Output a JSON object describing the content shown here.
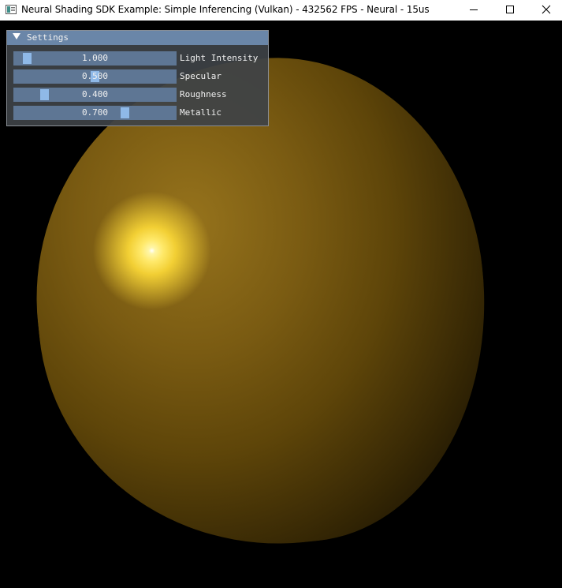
{
  "window": {
    "title": "Neural Shading SDK Example: Simple Inferencing (Vulkan) - 432562 FPS  - Neural -  15us"
  },
  "settings": {
    "header": "Settings",
    "sliders": [
      {
        "label": "Light Intensity",
        "value": "1.000",
        "fraction": 0.04
      },
      {
        "label": "Specular",
        "value": "0.500",
        "fraction": 0.5
      },
      {
        "label": "Roughness",
        "value": "0.400",
        "fraction": 0.16
      },
      {
        "label": "Metallic",
        "value": "0.700",
        "fraction": 0.7
      }
    ]
  },
  "colors": {
    "titlebar_bg": "#ffffff",
    "panel_header": "#6a86a8",
    "slider_frame": "#5e7694",
    "slider_grab": "#8fb9e8",
    "sphere_base": "#7a5b12",
    "highlight": "#ffe96a"
  }
}
